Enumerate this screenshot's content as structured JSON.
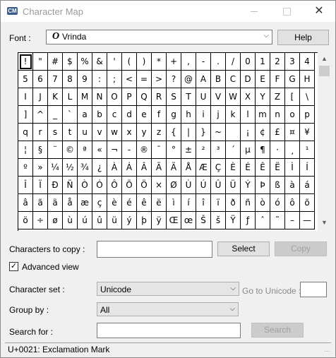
{
  "window": {
    "title": "Character Map",
    "app_icon_label": "CM",
    "close_glyph": "✕"
  },
  "font": {
    "label": "Font :",
    "glyph": "O",
    "value": "Vrinda",
    "help_label": "Help"
  },
  "grid": {
    "selected_index": 0,
    "characters": [
      "!",
      "\"",
      "#",
      "$",
      "%",
      "&",
      "'",
      "(",
      ")",
      "*",
      "+",
      ",",
      "-",
      ".",
      "/",
      "0",
      "1",
      "2",
      "3",
      "4",
      "5",
      "6",
      "7",
      "8",
      "9",
      ":",
      ";",
      "<",
      "=",
      ">",
      "?",
      "@",
      "A",
      "B",
      "C",
      "D",
      "E",
      "F",
      "G",
      "H",
      "I",
      "J",
      "K",
      "L",
      "M",
      "N",
      "O",
      "P",
      "Q",
      "R",
      "S",
      "T",
      "U",
      "V",
      "W",
      "X",
      "Y",
      "Z",
      "[",
      "\\",
      "]",
      "^",
      "_",
      "`",
      "a",
      "b",
      "c",
      "d",
      "e",
      "f",
      "g",
      "h",
      "i",
      "j",
      "k",
      "l",
      "m",
      "n",
      "o",
      "p",
      "q",
      "r",
      "s",
      "t",
      "u",
      "v",
      "w",
      "x",
      "y",
      "z",
      "{",
      "|",
      "}",
      "~",
      " ",
      "¡",
      "¢",
      "£",
      "¤",
      "¥",
      "¦",
      "§",
      "¨",
      "©",
      "ª",
      "«",
      "¬",
      "-",
      "®",
      "¯",
      "°",
      "±",
      "²",
      "³",
      "´",
      "µ",
      "¶",
      "·",
      "¸",
      "¹",
      "º",
      "»",
      "¼",
      "½",
      "¾",
      "¿",
      "À",
      "Á",
      "Â",
      "Ã",
      "Ä",
      "Å",
      "Æ",
      "Ç",
      "È",
      "É",
      "Ê",
      "Ë",
      "Ì",
      "Í",
      "Î",
      "Ï",
      "Ð",
      "Ñ",
      "Ò",
      "Ó",
      "Ô",
      "Õ",
      "Ö",
      "×",
      "Ø",
      "Ù",
      "Ú",
      "Û",
      "Ü",
      "Ý",
      "Þ",
      "ß",
      "à",
      "á",
      "â",
      "ã",
      "ä",
      "å",
      "æ",
      "ç",
      "è",
      "é",
      "ê",
      "ë",
      "ì",
      "í",
      "î",
      "ï",
      "ð",
      "ñ",
      "ò",
      "ó",
      "ô",
      "õ",
      "ö",
      "÷",
      "ø",
      "ù",
      "ú",
      "û",
      "ü",
      "ý",
      "þ",
      "ÿ",
      "Œ",
      "œ",
      "Š",
      "š",
      "Ÿ",
      "ƒ",
      "ˆ",
      "˜",
      "–",
      "—"
    ]
  },
  "copy": {
    "label": "Characters to copy :",
    "value": "",
    "select_label": "Select",
    "copy_label": "Copy"
  },
  "advanced": {
    "label": "Advanced view",
    "checked": "✓"
  },
  "charset": {
    "label": "Character set :",
    "value": "Unicode",
    "goto_label": "Go to Unicode :",
    "goto_value": ""
  },
  "groupby": {
    "label": "Group by :",
    "value": "All"
  },
  "search": {
    "label": "Search for :",
    "value": "",
    "button_label": "Search"
  },
  "status": {
    "text": "U+0021: Exclamation Mark"
  }
}
